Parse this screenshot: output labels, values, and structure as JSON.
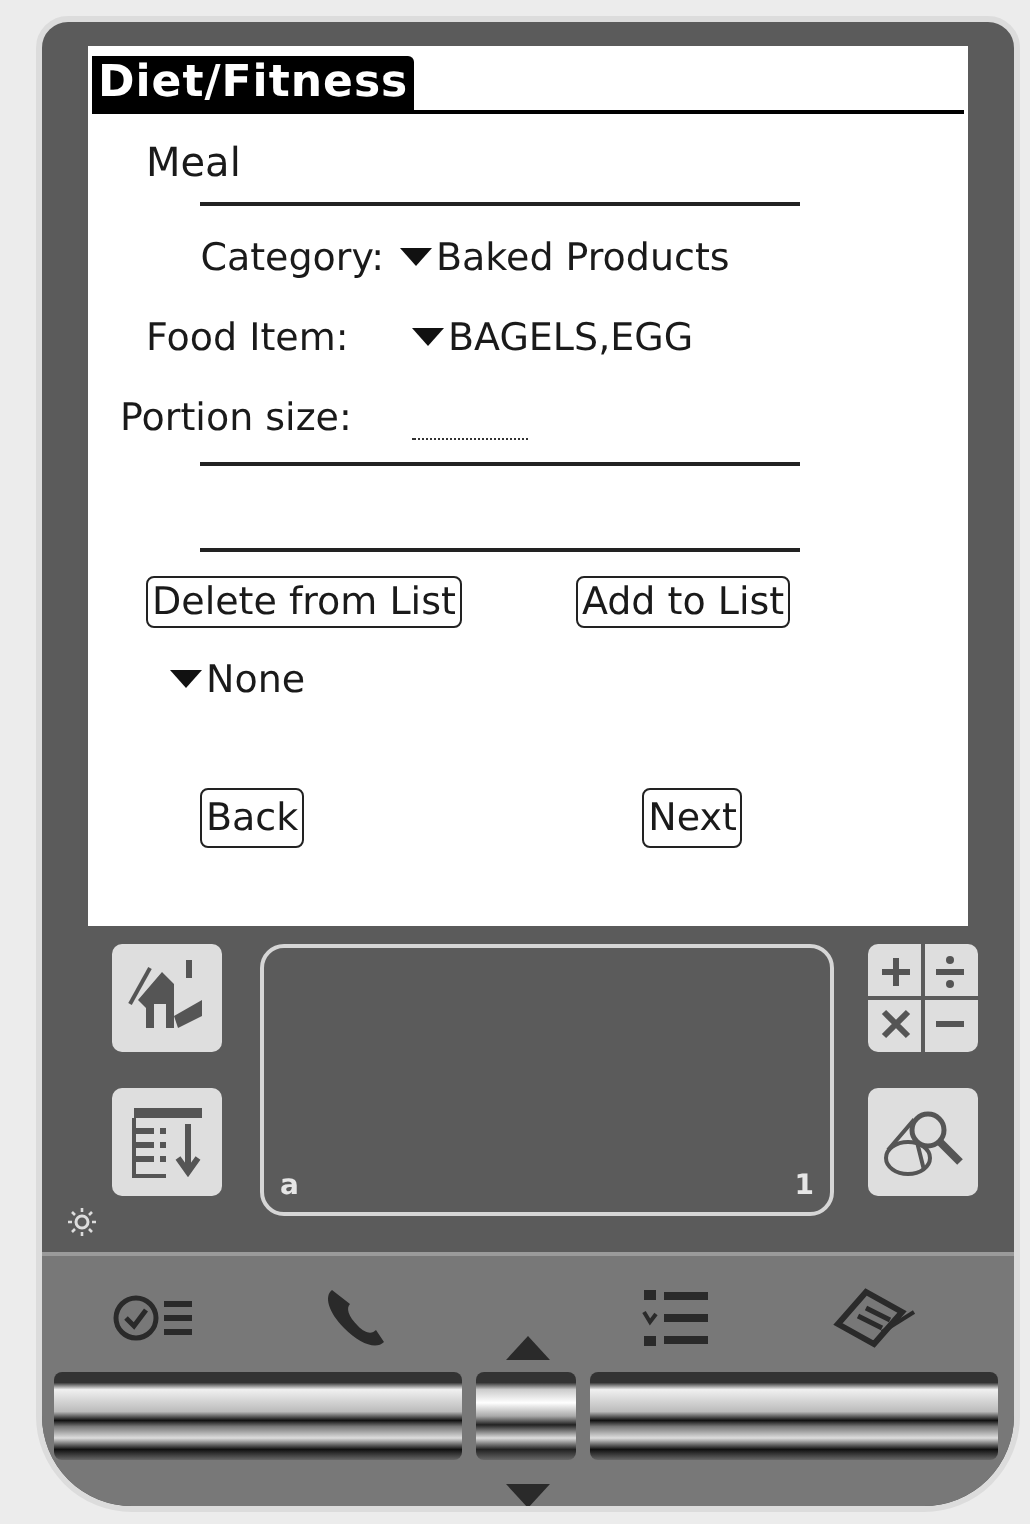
{
  "title": "Diet/Fitness",
  "meal_label": "Meal",
  "fields": [
    {
      "kind": "popup",
      "label": "Category:",
      "value": "Baked Products"
    },
    {
      "kind": "popup",
      "label": "Food Item:",
      "value": "BAGELS,EGG"
    },
    {
      "kind": "input",
      "label": "Portion size:"
    }
  ],
  "list_buttons": [
    "Delete from List",
    "Add to List"
  ],
  "list_popup": {
    "value": "None"
  },
  "nav_buttons": [
    "Back",
    "Next"
  ],
  "graffiti": {
    "left_label": "a",
    "right_label": "1"
  }
}
